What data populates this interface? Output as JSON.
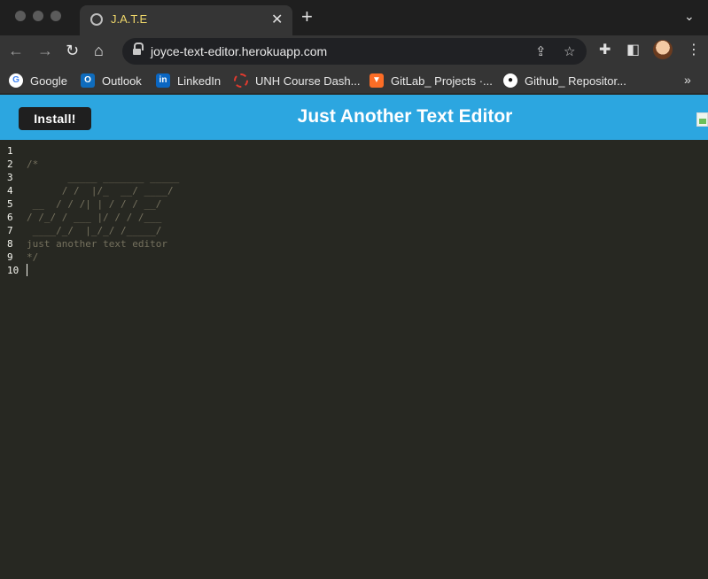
{
  "browser": {
    "tab": {
      "title": "J.A.T.E"
    },
    "address": {
      "url": "joyce-text-editor.herokuapp.com"
    },
    "bookmarks": [
      {
        "label": "Google",
        "icon": "google-icon",
        "color": "#4285f4"
      },
      {
        "label": "Outlook",
        "icon": "outlook-icon",
        "color": "#0f6cbd"
      },
      {
        "label": "LinkedIn",
        "icon": "linkedin-icon",
        "color": "#0a66c2"
      },
      {
        "label": "UNH Course Dash...",
        "icon": "course-icon",
        "color": "#e03a2f"
      },
      {
        "label": "GitLab_ Projects ·...",
        "icon": "gitlab-icon",
        "color": "#fc6d26"
      },
      {
        "label": "Github_ Repositor...",
        "icon": "github-icon",
        "color": "#ffffff"
      }
    ]
  },
  "app": {
    "install_label": "Install!",
    "title": "Just Another Text Editor",
    "accent": "#2ca6e0"
  },
  "editor": {
    "line_numbers": [
      "1",
      "2",
      "3",
      "4",
      "5",
      "6",
      "7",
      "8",
      "9",
      "10"
    ],
    "lines": [
      "",
      "/*",
      "       _____ _______ _____",
      "      / /  |/_  __/ ____/",
      " __  / / /| | / / / __/",
      "/ /_/ / ___ |/ / / /___",
      " ____/_/  |_/_/ /_____/",
      "just another text editor",
      "*/",
      ""
    ],
    "cursor_line": 10
  }
}
